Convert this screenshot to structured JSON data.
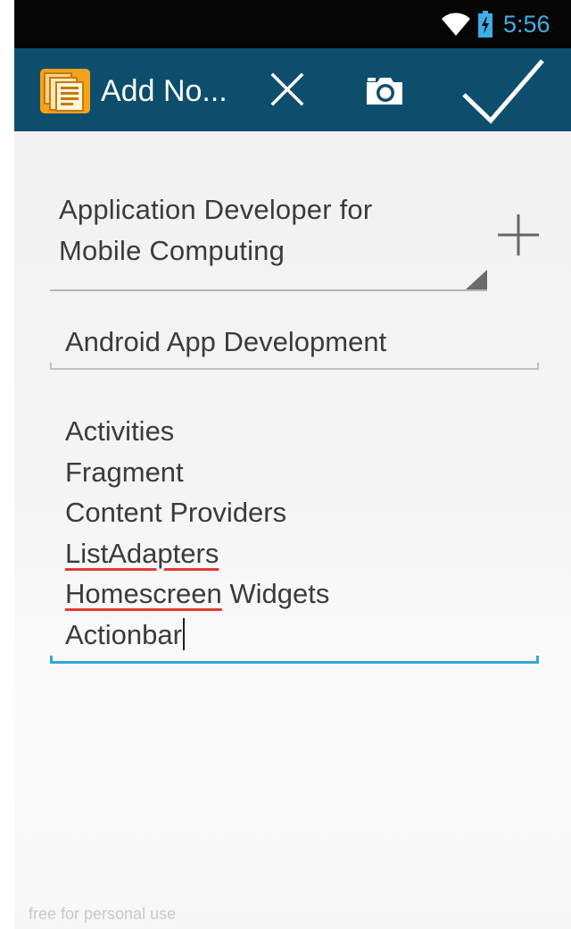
{
  "status_bar": {
    "time": "5:56",
    "icons": [
      "wifi-icon",
      "battery-charging-icon"
    ],
    "time_color": "#3daee6"
  },
  "action_bar": {
    "title": "Add No...",
    "background": "#0d4e6d",
    "actions": [
      "cancel-x-icon",
      "camera-icon",
      "checkmark-icon"
    ]
  },
  "form": {
    "category": {
      "line1": "Application Developer for",
      "line2": "Mobile Computing",
      "add_icon": "plus-icon"
    },
    "title_field": {
      "value": "Android App Development"
    },
    "body_field": {
      "lines": [
        "Activities",
        "Fragment",
        "Content Providers",
        "ListAdapters",
        "Homescreen",
        " Widgets",
        "Actionbar"
      ],
      "misspelled": [
        "ListAdapters",
        "Homescreen"
      ],
      "focus_color": "#33a6d8"
    }
  },
  "watermark": "free for personal use"
}
